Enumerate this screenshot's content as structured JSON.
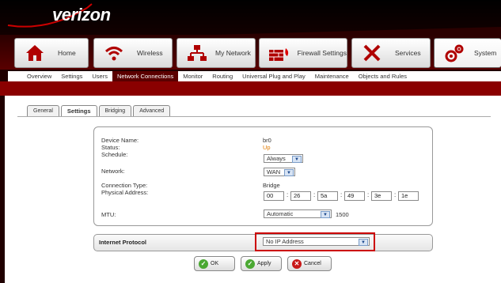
{
  "brand": {
    "logo_text": "verizon"
  },
  "main_tabs": [
    {
      "label": "Home",
      "icon": "house-icon"
    },
    {
      "label": "Wireless",
      "icon": "wifi-icon"
    },
    {
      "label": "My Network",
      "icon": "network-icon"
    },
    {
      "label": "Firewall Settings",
      "icon": "firewall-icon"
    },
    {
      "label": "Services",
      "icon": "tools-icon"
    },
    {
      "label": "System",
      "icon": "gears-icon"
    }
  ],
  "sub_nav": [
    "Overview",
    "Settings",
    "Users",
    "Network Connections",
    "Monitor",
    "Routing",
    "Universal Plug and Play",
    "Maintenance",
    "Objects and Rules"
  ],
  "sub_nav_selected": "Network Connections",
  "content_tabs": [
    "General",
    "Settings",
    "Bridging",
    "Advanced"
  ],
  "content_tab_selected": "Settings",
  "fields": {
    "device_name_label": "Device Name:",
    "device_name_value": "br0",
    "status_label": "Status:",
    "status_value": "Up",
    "schedule_label": "Schedule:",
    "schedule_value": "Always",
    "network_label": "Network:",
    "network_value": "WAN",
    "connection_type_label": "Connection Type:",
    "connection_type_value": "Bridge",
    "physical_address_label": "Physical Address:",
    "mac": [
      "00",
      "26",
      "5a",
      "49",
      "3e",
      "1e"
    ],
    "mtu_label": "MTU:",
    "mtu_mode": "Automatic",
    "mtu_value": "1500"
  },
  "internet_protocol": {
    "label": "Internet Protocol",
    "value": "No IP Address"
  },
  "buttons": {
    "ok": "OK",
    "apply": "Apply",
    "cancel": "Cancel"
  },
  "colors": {
    "brand_red": "#8a0000",
    "status_up": "#e07a00",
    "highlight": "#cc0000"
  }
}
